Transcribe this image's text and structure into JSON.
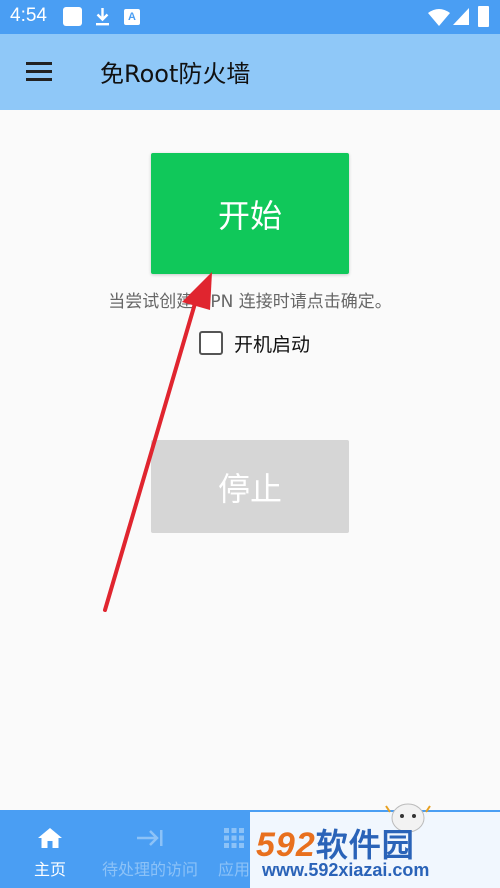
{
  "status_bar": {
    "time": "4:54",
    "icons": [
      "notification-square-icon",
      "download-icon",
      "a-app-icon",
      "wifi-icon",
      "signal-icon",
      "battery-icon"
    ],
    "a_icon_text": "A"
  },
  "app_bar": {
    "title": "免Root防火墙",
    "menu_icon": "hamburger-menu-icon"
  },
  "main": {
    "start_button": "开始",
    "hint": "当尝试创建 VPN 连接时请点击确定。",
    "autostart_label": "开机启动",
    "autostart_checked": false,
    "stop_button": "停止"
  },
  "bottom_nav": {
    "items": [
      {
        "label": "主页",
        "icon": "home-icon",
        "active": true
      },
      {
        "label": "待处理的访问",
        "icon": "arrow-to-line-icon",
        "active": false
      },
      {
        "label": "应用",
        "icon": "grid-icon",
        "active": false
      }
    ]
  },
  "watermark": {
    "logo_num": "592",
    "logo_cn": "软件园",
    "url": "www.592xiazai.com"
  },
  "colors": {
    "status_bar": "#4a9ef3",
    "app_bar": "#8fc8f8",
    "start_button": "#10c85a",
    "stop_button": "#d6d6d6",
    "arrow": "#e0252f"
  }
}
